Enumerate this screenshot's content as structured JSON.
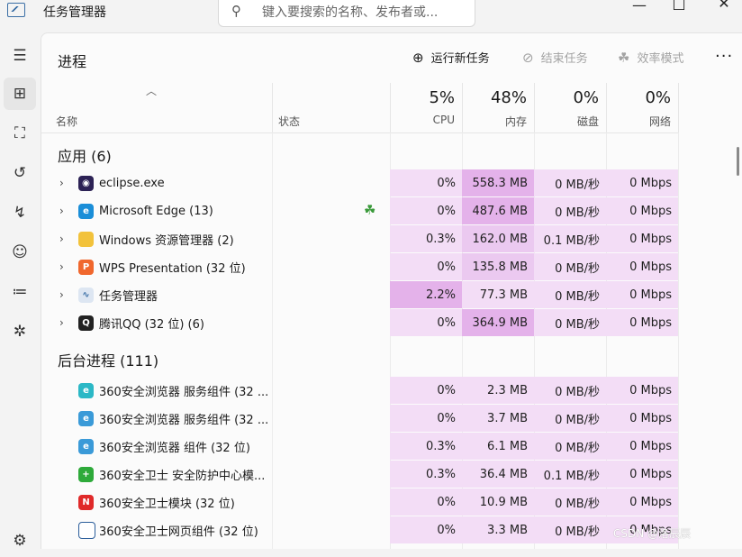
{
  "window": {
    "title": "任务管理器"
  },
  "search": {
    "placeholder": "键入要搜索的名称、发布者或..."
  },
  "panel": {
    "title": "进程"
  },
  "toolbar": {
    "run_new_task": "运行新任务",
    "end_task": "结束任务",
    "efficiency_mode": "效率模式",
    "more": "···"
  },
  "columns": {
    "name": "名称",
    "status": "状态",
    "cpu": {
      "pct": "5%",
      "label": "CPU"
    },
    "memory": {
      "pct": "48%",
      "label": "内存"
    },
    "disk": {
      "pct": "0%",
      "label": "磁盘"
    },
    "network": {
      "pct": "0%",
      "label": "网络"
    }
  },
  "groups": {
    "apps": "应用 (6)",
    "background": "后台进程 (111)"
  },
  "apps": [
    {
      "name": "eclipse.exe",
      "cpu": "0%",
      "mem": "558.3 MB",
      "disk": "0 MB/秒",
      "net": "0 Mbps",
      "icon": "eclipse-icon"
    },
    {
      "name": "Microsoft Edge (13)",
      "cpu": "0%",
      "mem": "487.6 MB",
      "disk": "0 MB/秒",
      "net": "0 Mbps",
      "icon": "edge-icon"
    },
    {
      "name": "Windows 资源管理器 (2)",
      "cpu": "0.3%",
      "mem": "162.0 MB",
      "disk": "0.1 MB/秒",
      "net": "0 Mbps",
      "icon": "folder-icon"
    },
    {
      "name": "WPS Presentation (32 位)",
      "cpu": "0%",
      "mem": "135.8 MB",
      "disk": "0 MB/秒",
      "net": "0 Mbps",
      "icon": "wps-icon"
    },
    {
      "name": "任务管理器",
      "cpu": "2.2%",
      "mem": "77.3 MB",
      "disk": "0 MB/秒",
      "net": "0 Mbps",
      "icon": "task-manager-icon"
    },
    {
      "name": "腾讯QQ (32 位) (6)",
      "cpu": "0%",
      "mem": "364.9 MB",
      "disk": "0 MB/秒",
      "net": "0 Mbps",
      "icon": "qq-icon"
    }
  ],
  "background": [
    {
      "name": "360安全浏览器 服务组件 (32 ...",
      "cpu": "0%",
      "mem": "2.3 MB",
      "disk": "0 MB/秒",
      "net": "0 Mbps",
      "icon": "360-browser-service-icon"
    },
    {
      "name": "360安全浏览器 服务组件 (32 ...",
      "cpu": "0%",
      "mem": "3.7 MB",
      "disk": "0 MB/秒",
      "net": "0 Mbps",
      "icon": "360-browser-icon"
    },
    {
      "name": "360安全浏览器 组件 (32 位)",
      "cpu": "0.3%",
      "mem": "6.1 MB",
      "disk": "0 MB/秒",
      "net": "0 Mbps",
      "icon": "360-browser-icon"
    },
    {
      "name": "360安全卫士 安全防护中心模...",
      "cpu": "0.3%",
      "mem": "36.4 MB",
      "disk": "0.1 MB/秒",
      "net": "0 Mbps",
      "icon": "360-safe-icon"
    },
    {
      "name": "360安全卫士模块 (32 位)",
      "cpu": "0%",
      "mem": "10.9 MB",
      "disk": "0 MB/秒",
      "net": "0 Mbps",
      "icon": "360-module-icon"
    },
    {
      "name": "360安全卫士网页组件 (32 位)",
      "cpu": "0%",
      "mem": "3.3 MB",
      "disk": "0 MB/秒",
      "net": "0 Mbps",
      "icon": "window-icon"
    }
  ],
  "watermark": "CSDN @洛辰辰",
  "colors": {
    "heat_light": "#f3ddf6",
    "heat_mid": "#ebc9f0",
    "heat_strong": "#e4b2ea",
    "background": "#f3f3f3"
  }
}
